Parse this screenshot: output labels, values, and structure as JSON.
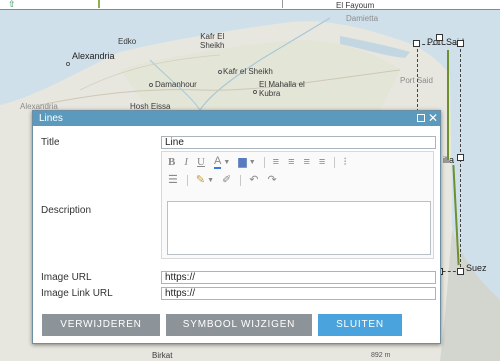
{
  "map": {
    "labels": {
      "el_fayoum": "El Fayoum",
      "damietta": "Damietta",
      "edko": "Edko",
      "kafr_el_sheikh_top": "Kafr El\nSheikh",
      "alexandria": "Alexandria",
      "port_said": "Port Said",
      "kafr_el_sheikh": "Kafr el Sheikh",
      "damanhour": "Damanhour",
      "el_mahalla": "El Mahalla el\nKubra",
      "port_said_faded": "Port Said",
      "alexandria_faded": "Alexandria",
      "hosh_eissa": "Hosh Eissa",
      "ilia": "ilia",
      "suez": "Suez",
      "birkat": "Birkat",
      "scale": "892 m"
    }
  },
  "dialog": {
    "title": "Lines",
    "fields": {
      "title_label": "Title",
      "title_value": "Line",
      "description_label": "Description",
      "image_url_label": "Image URL",
      "image_url_value": "https://",
      "image_link_label": "Image Link URL",
      "image_link_value": "https://"
    },
    "toolbar": {
      "bold": "B",
      "italic": "I",
      "underline": "U"
    },
    "buttons": {
      "delete": "VERWIJDEREN",
      "change_symbol": "SYMBOOL WIJZIGEN",
      "close": "SLUITEN"
    }
  },
  "colors": {
    "header": "#5b9abd",
    "button_grey": "#8d9499",
    "button_blue": "#4aa3dc"
  }
}
